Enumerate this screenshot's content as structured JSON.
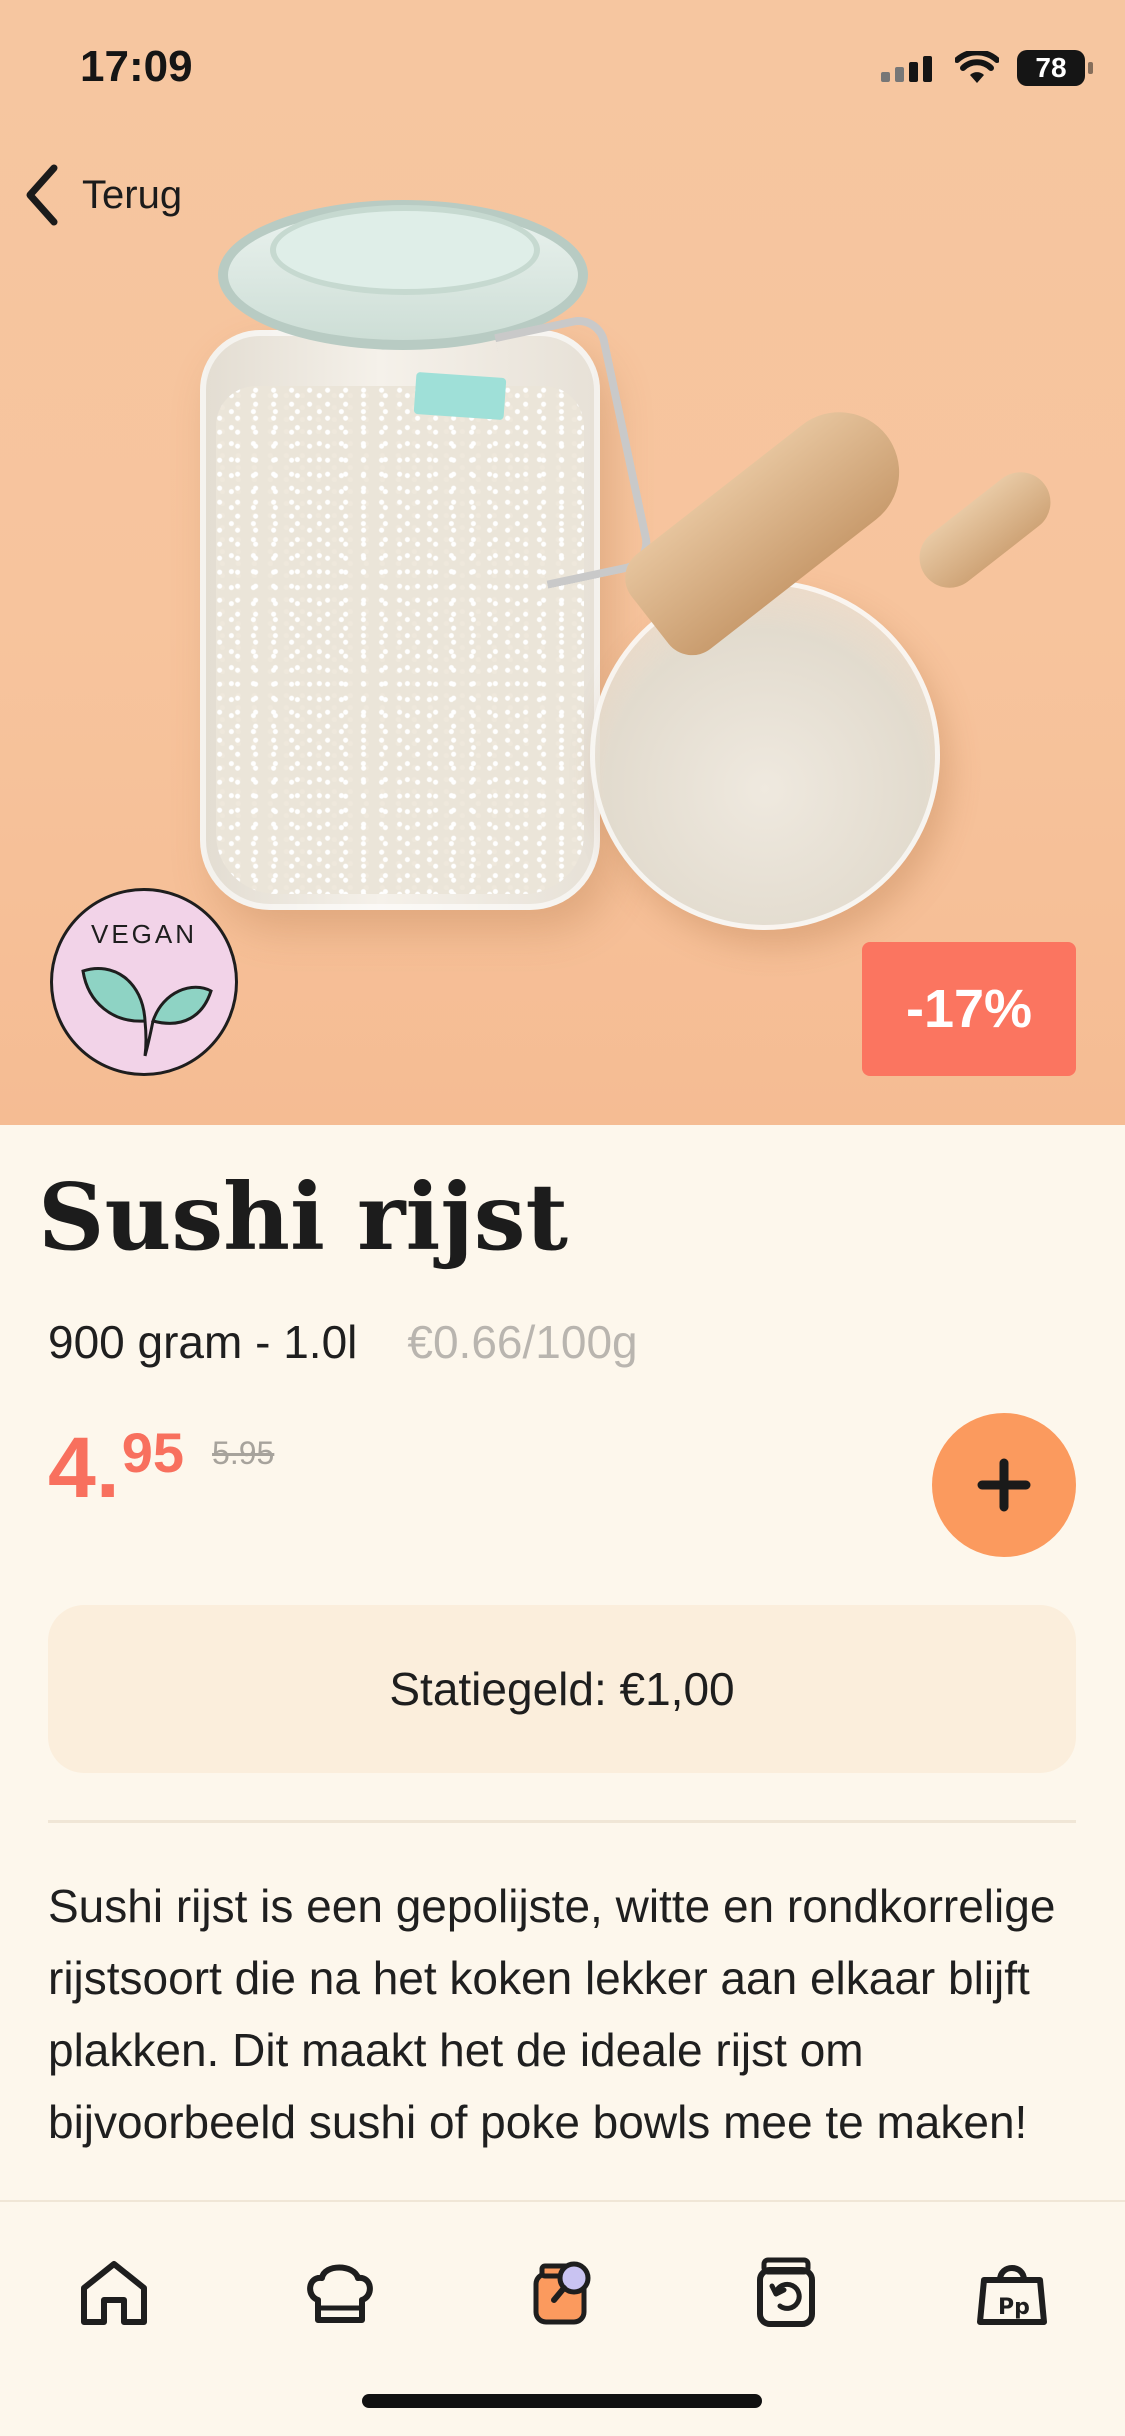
{
  "status_bar": {
    "time": "17:09",
    "battery": "78"
  },
  "nav": {
    "back_label": "Terug"
  },
  "hero": {
    "badge_vegan": "VEGAN",
    "discount": "-17%"
  },
  "product": {
    "title": "Sushi rijst",
    "weight": "900 gram - 1.0l",
    "unit_price": "€0.66/100g",
    "price_int": "4.",
    "price_dec": "95",
    "price_old": "5.95",
    "deposit": "Statiegeld: €1,00",
    "description": "Sushi rijst is een gepolijste, witte en rondkorrelige rijstsoort die na het koken lekker aan elkaar blijft plakken. Dit maakt het de ideale rijst om bijvoorbeeld sushi of poke bowls mee te maken!"
  },
  "tabbar": {
    "items": [
      {
        "icon": "home-icon"
      },
      {
        "icon": "chef-hat-icon"
      },
      {
        "icon": "jar-search-icon",
        "active": true
      },
      {
        "icon": "jar-return-icon"
      },
      {
        "icon": "shopping-bag-icon"
      }
    ]
  },
  "colors": {
    "accent": "#fb9a5e",
    "discount": "#fb7560",
    "price": "#f8705e",
    "background": "#fdf7ec"
  }
}
